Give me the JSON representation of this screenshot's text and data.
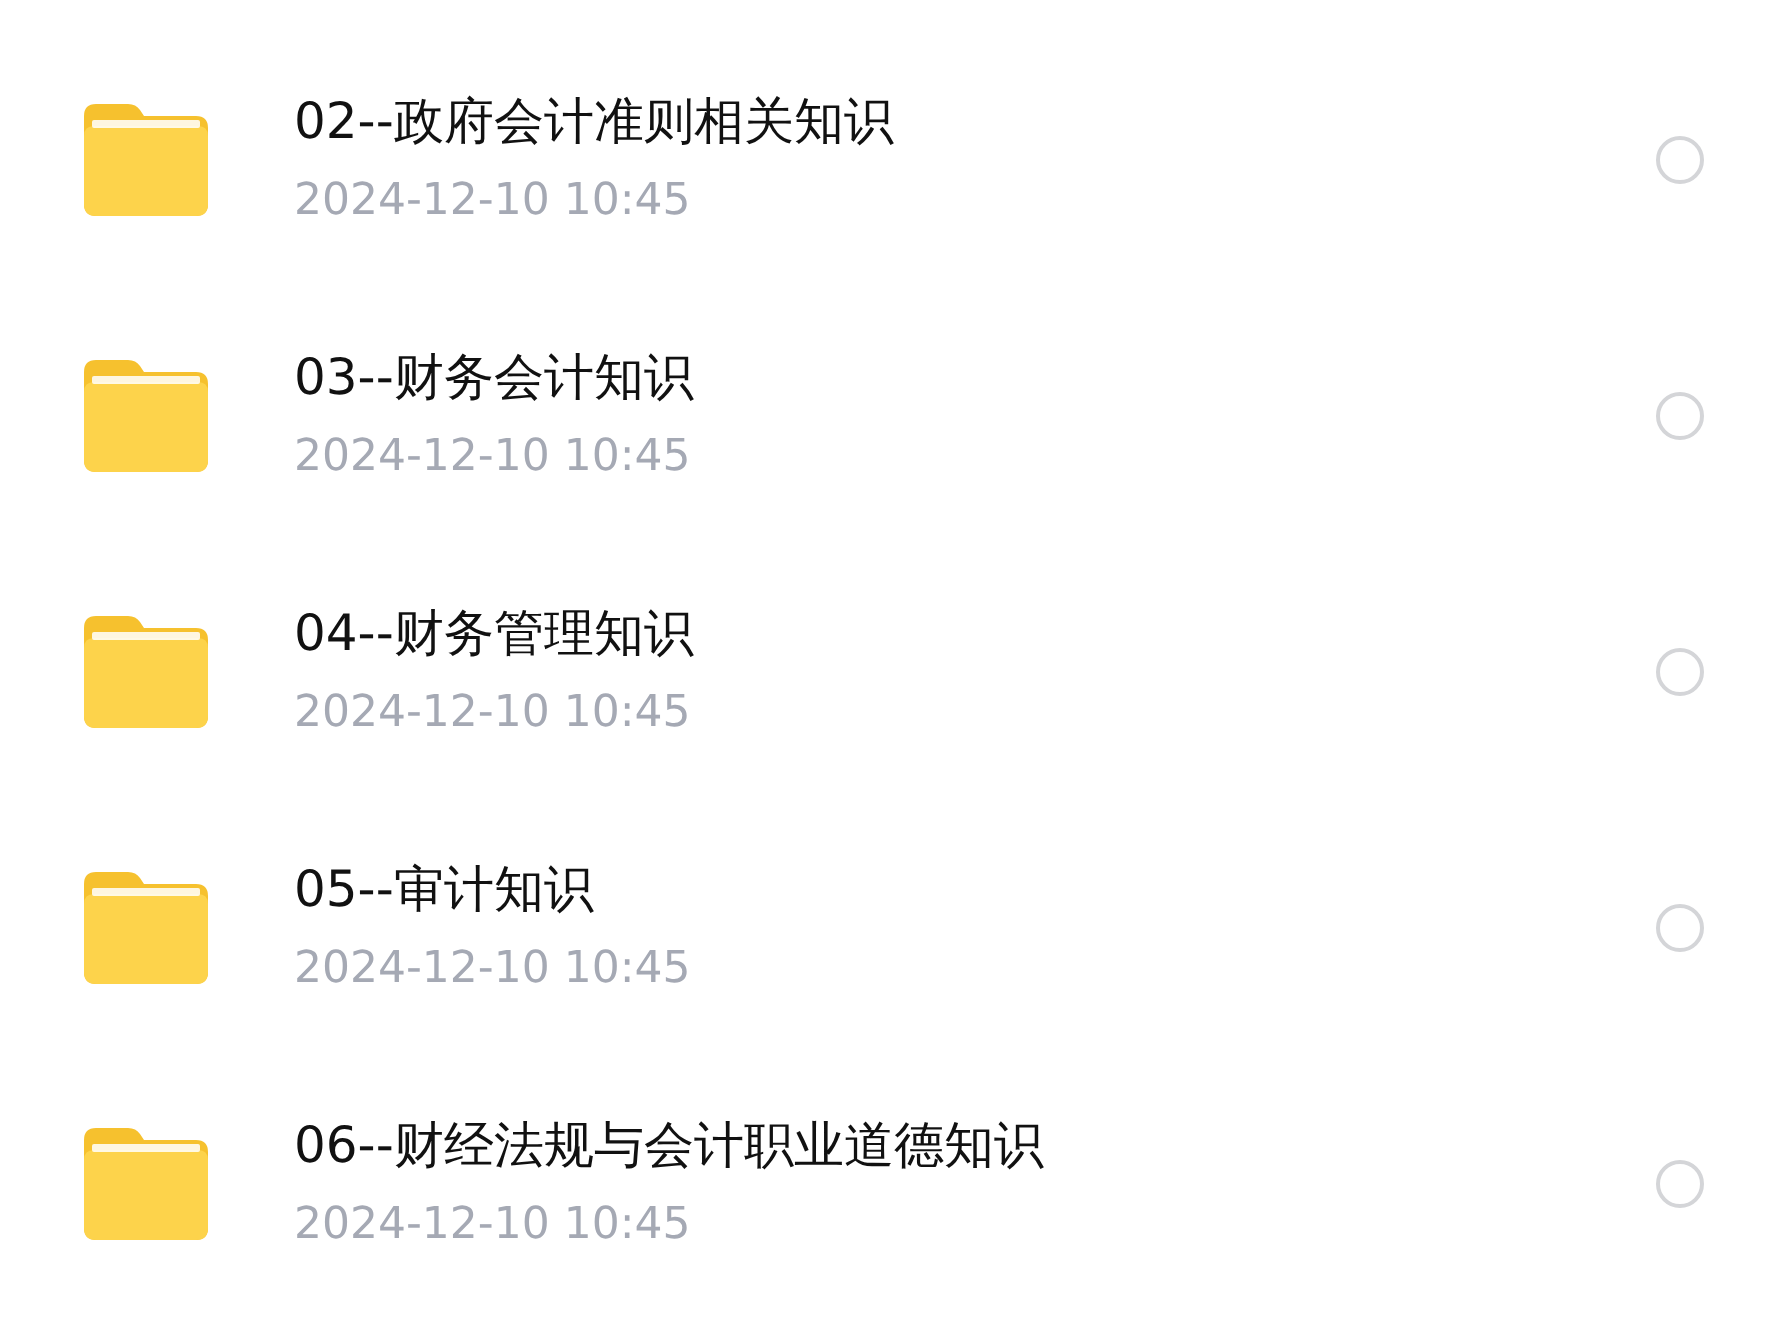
{
  "folders": [
    {
      "name": "02--政府会计准则相关知识",
      "date": "2024-12-10 10:45",
      "selected": false
    },
    {
      "name": "03--财务会计知识",
      "date": "2024-12-10 10:45",
      "selected": false
    },
    {
      "name": "04--财务管理知识",
      "date": "2024-12-10 10:45",
      "selected": false
    },
    {
      "name": "05--审计知识",
      "date": "2024-12-10 10:45",
      "selected": false
    },
    {
      "name": "06--财经法规与会计职业道德知识",
      "date": "2024-12-10 10:45",
      "selected": false
    }
  ]
}
